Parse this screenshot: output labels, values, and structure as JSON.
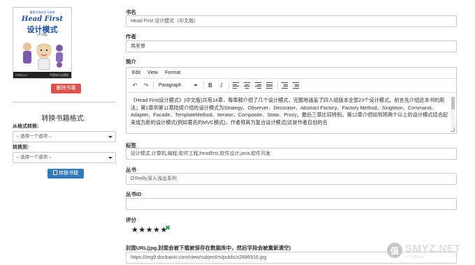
{
  "book_cover": {
    "top_text": "重磅大脑的学习指南",
    "title_en": "Head First",
    "title_cn": "设计模式",
    "subtitle": "(中文版)",
    "publisher": "O'REILLY",
    "press": "中国电力出版社"
  },
  "left": {
    "delete_button": "删除书籍",
    "convert_heading": "转换书籍格式:",
    "from_label": "从格式转换:",
    "from_value": "-- 选择一个选项 --",
    "to_label": "转换到:",
    "to_value": "-- 选择一个选项 --",
    "convert_button": "转换书籍"
  },
  "form": {
    "title_label": "书名",
    "title_value": "Head First 设计模式（中文版）",
    "author_label": "作者",
    "author_value": "弗里曼",
    "desc_label": "简介",
    "editor_menu": [
      "Edit",
      "View",
      "Format"
    ],
    "paragraph_select": "Paragraph",
    "description": "《Head First设计模式》(中文版)共有14章，每章都介绍了几个设计模式，完整地涵盖了四人组版本全部23个设计模式。前言先介绍这本书的用法；第1章到第11章陆续介绍的设计模式为Strategy、Observer、Decorator、Abstract Factory、Factory Method、Singleton、Command、Adapter、Facade、TemplateMethod、Iterator、Composite、State、Proxy。最后三章比较特别。第12章介绍如何将两个以上的设计模式结合起来成为新的设计模式(例如著名的MVC模式)，作者称其为复合设计模式(这是作者自创的名",
    "tags_label": "标签",
    "tags_value": "设计模式,计算机,编程,软件工程,headfirst,软件设计,java,软件开发",
    "series_label": "丛书",
    "series_value": "O'Reilly深入浅出系列",
    "series_id_label": "丛书ID",
    "series_id_value": "",
    "rating_label": "评分",
    "rating_stars": "★★★★★",
    "rating_value": 5,
    "rating_clear": "✖",
    "cover_url_label": "封面URL(jpg,封面会被下载被保存在数据库中，然后字段会被重新清空)",
    "cover_url_value": "https://img9.doubanio.com/view/subject/m/public/s2686916.jpg"
  },
  "watermark": {
    "badge": "值",
    "text": "SMYZ.NET",
    "sub": "什么值得买"
  }
}
